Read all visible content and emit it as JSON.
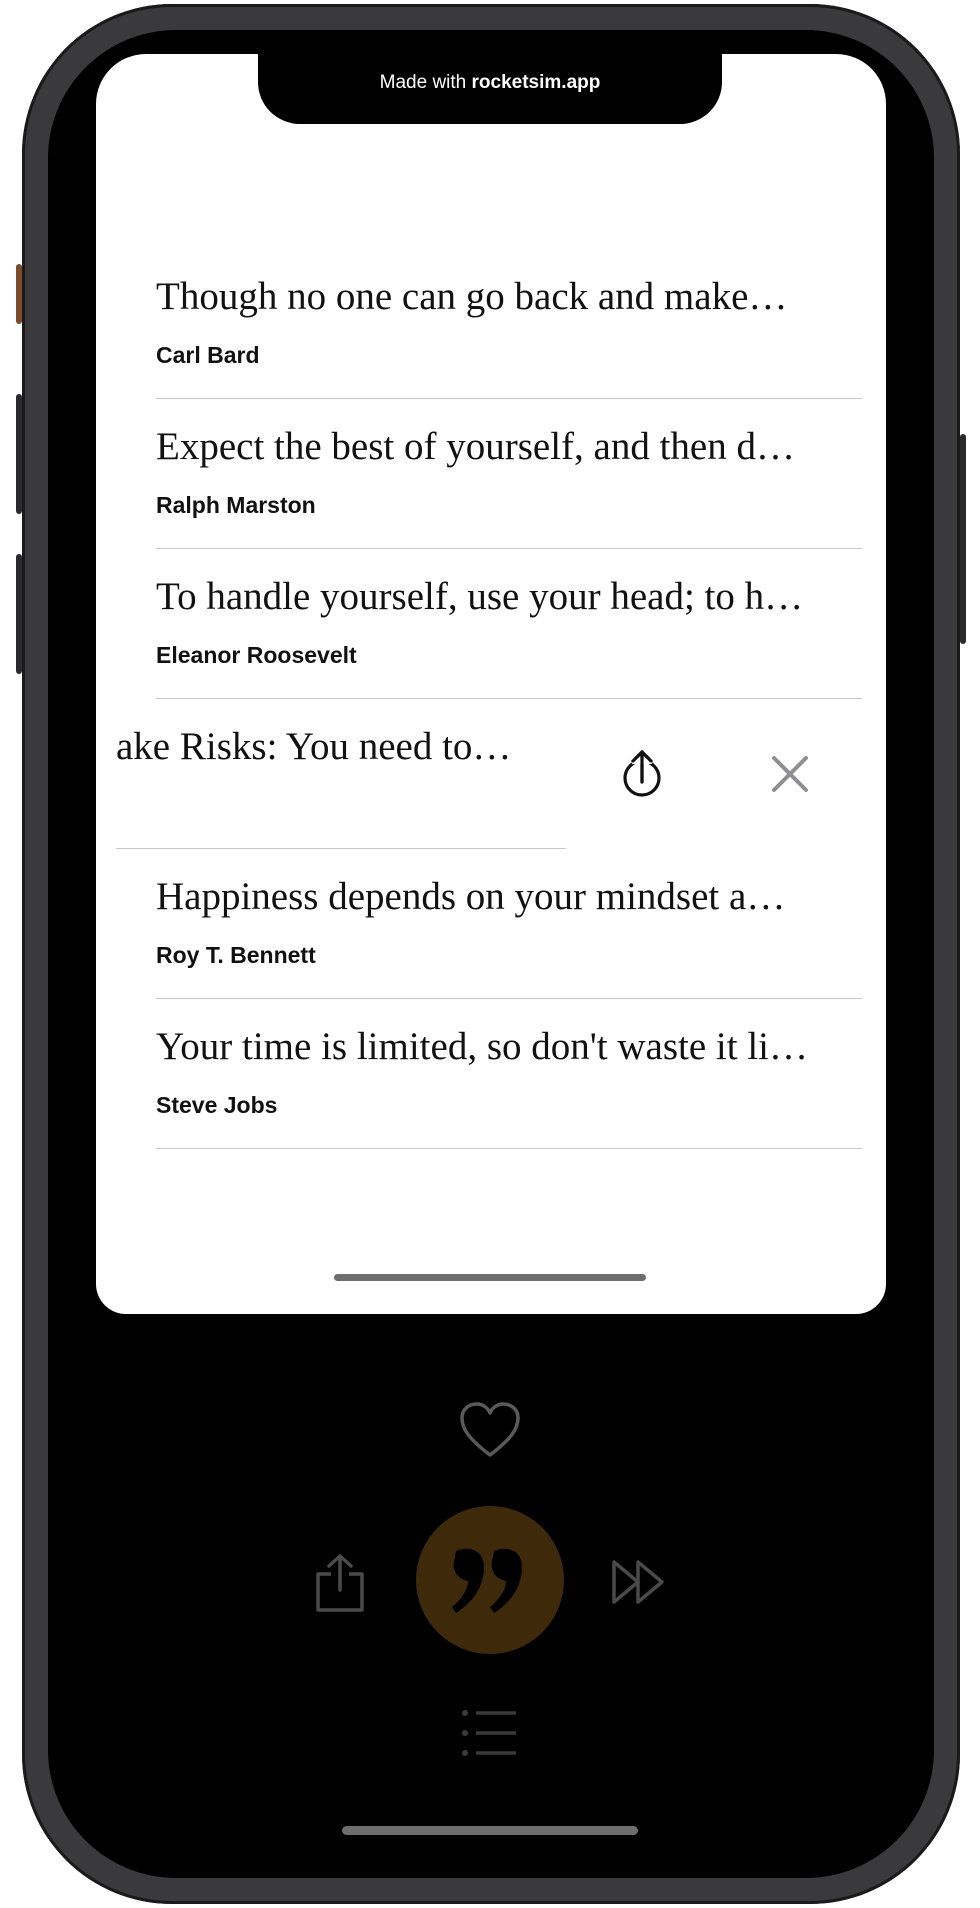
{
  "banner": {
    "prefix": "Made with",
    "brand": "rocketsim.app"
  },
  "quotes": [
    {
      "text": "Though no one can go back and make…",
      "author": "Carl Bard"
    },
    {
      "text": "Expect the best of yourself, and then d…",
      "author": "Ralph Marston"
    },
    {
      "text": "To handle yourself, use your head; to h…",
      "author": "Eleanor Roosevelt"
    },
    {
      "text": "ake Risks: You need to…",
      "author": ""
    },
    {
      "text": "Happiness depends on your mindset a…",
      "author": "Roy T. Bennett"
    },
    {
      "text": "Your time is limited, so don't waste it li…",
      "author": "Steve Jobs"
    }
  ],
  "swipe_actions": {
    "share_icon": "share-circle-icon",
    "delete_icon": "close-icon"
  },
  "controls": {
    "favorite_icon": "heart-icon",
    "share_icon": "share-icon",
    "main_icon": "quote-icon",
    "next_icon": "fast-forward-icon",
    "list_icon": "list-icon"
  },
  "colors": {
    "accent": "#7a4f12",
    "sheet": "#ffffff",
    "background": "#000000"
  }
}
